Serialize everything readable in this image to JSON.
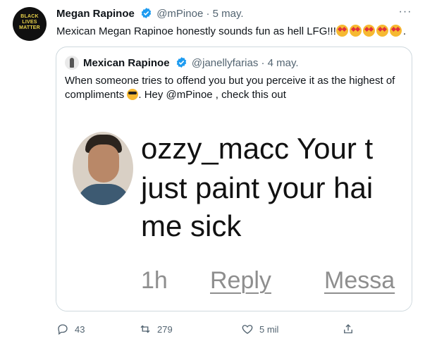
{
  "tweet": {
    "avatar_text": "BLACK\nLIVES\nMATTER",
    "name": "Megan Rapinoe",
    "handle": "@mPinoe",
    "dot": "·",
    "date": "5 may.",
    "text": "Mexican Megan Rapinoe honestly sounds fun as hell LFG!!!",
    "text_tail": ".",
    "emoji_icon": "star-struck-emoji",
    "emoji_count": 5
  },
  "quote": {
    "name": "Mexican Rapinoe",
    "handle": "@janellyfarias",
    "dot": "·",
    "date": "4 may.",
    "text_line1": "When someone tries to offend you but you perceive it as the highest of",
    "text_line2_a": "compliments",
    "text_line2_b": ". Hey @mPinoe , check this out",
    "emoji_icon": "sunglasses-emoji"
  },
  "media": {
    "line1": "ozzy_macc Your t",
    "line2": "just paint your hai",
    "line3": "me sick",
    "time": "1h",
    "reply": "Reply",
    "message": "Messa"
  },
  "actions": {
    "replies": "43",
    "retweets": "279",
    "likes": "5 mil"
  },
  "colors": {
    "verified": "#1d9bf0",
    "secondary_text": "#536471",
    "border": "#cfd9de"
  }
}
